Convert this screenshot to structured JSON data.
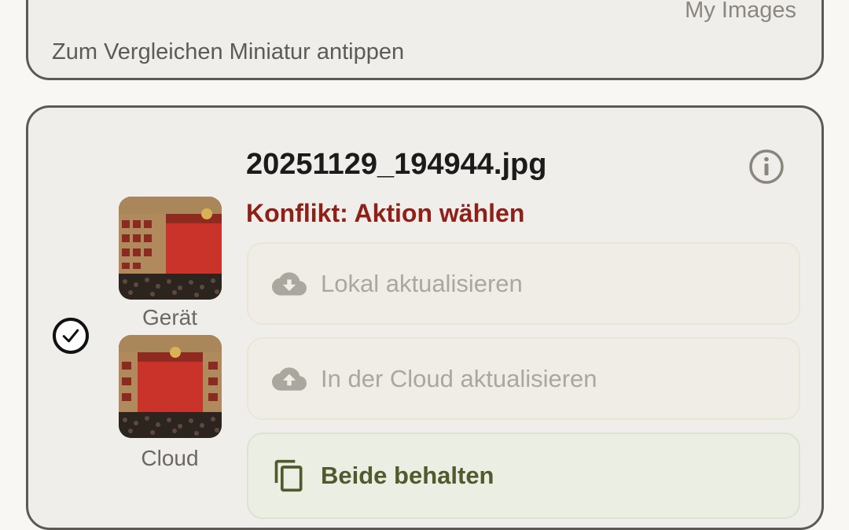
{
  "top_card": {
    "source_label": "My Images",
    "hint": "Zum Vergleichen Miniatur antippen"
  },
  "item": {
    "filename": "20251129_194944.jpg",
    "status": "Konflikt: Aktion wählen",
    "status_color": "#8f2018",
    "device_label": "Gerät",
    "cloud_label": "Cloud",
    "check_icon": "check-circle-icon",
    "info_icon": "info-icon"
  },
  "actions": [
    {
      "label": "Lokal aktualisieren",
      "icon": "cloud-download-icon",
      "enabled": false
    },
    {
      "label": "In der Cloud aktualisieren",
      "icon": "cloud-upload-icon",
      "enabled": false
    },
    {
      "label": "Beide behalten",
      "icon": "copy-icon",
      "enabled": true
    }
  ],
  "colors": {
    "accent_green": "#4f5b2c",
    "conflict_red": "#8f2018",
    "card_border": "#5d5a55"
  }
}
